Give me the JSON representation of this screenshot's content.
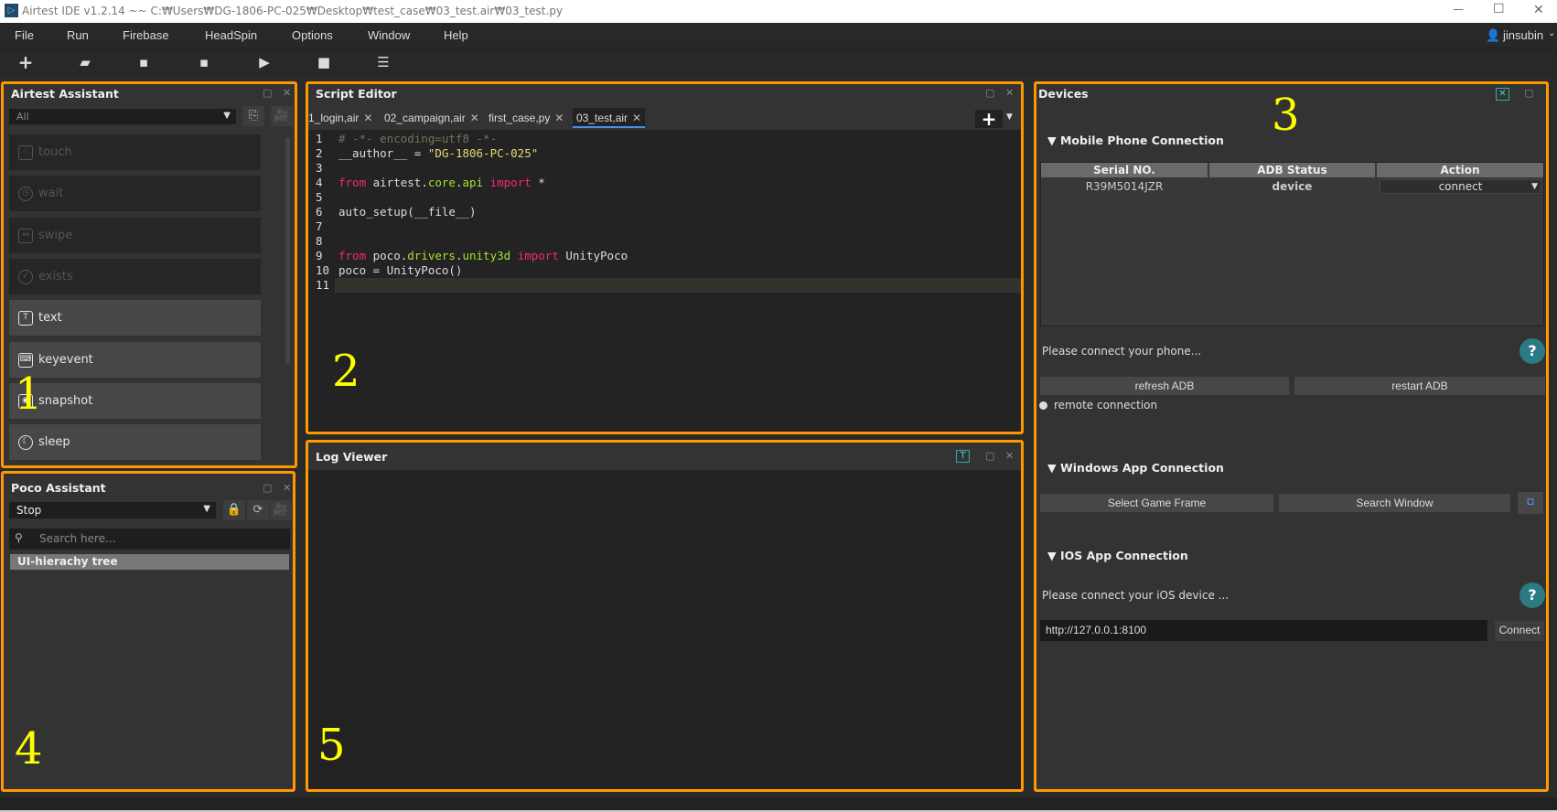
{
  "window": {
    "title": "Airtest IDE v1.2.14 ~~ C:₩Users₩DG-1806-PC-025₩Desktop₩test_case₩03_test.air₩03_test.py",
    "minimize": "—",
    "maximize": "☐",
    "close": "✕"
  },
  "menu": [
    "File",
    "Run",
    "Firebase",
    "HeadSpin",
    "Options",
    "Window",
    "Help"
  ],
  "user": {
    "name": "jinsubin"
  },
  "toolbar": {
    "icons": [
      "new-icon",
      "open-folder-icon",
      "save-icon",
      "save-as-icon",
      "run-icon",
      "stop-icon",
      "log-icon"
    ]
  },
  "airtest_assistant": {
    "title": "Airtest Assistant",
    "filter": "All",
    "items": [
      {
        "label": "touch",
        "enabled": false
      },
      {
        "label": "wait",
        "enabled": false
      },
      {
        "label": "swipe",
        "enabled": false
      },
      {
        "label": "exists",
        "enabled": false
      },
      {
        "label": "text",
        "enabled": true
      },
      {
        "label": "keyevent",
        "enabled": true
      },
      {
        "label": "snapshot",
        "enabled": true
      },
      {
        "label": "sleep",
        "enabled": true
      }
    ]
  },
  "poco_assistant": {
    "title": "Poco Assistant",
    "mode": "Stop",
    "search_placeholder": "Search here...",
    "tree_label": "UI-hierachy tree"
  },
  "script_editor": {
    "title": "Script Editor",
    "tabs": [
      {
        "label": "1_login,air",
        "active": false
      },
      {
        "label": "02_campaign,air",
        "active": false
      },
      {
        "label": "first_case,py",
        "active": false
      },
      {
        "label": "03_test,air",
        "active": true
      }
    ],
    "lines": [
      "# -*- encoding=utf8 -*-",
      "__author__ = \"DG-1806-PC-025\"",
      "",
      "from airtest.core.api import *",
      "",
      "auto_setup(__file__)",
      "",
      "",
      "from poco.drivers.unity3d import UnityPoco",
      "poco = UnityPoco()",
      ""
    ],
    "current_line": 11
  },
  "log_viewer": {
    "title": "Log Viewer"
  },
  "devices": {
    "title": "Devices",
    "mobile": {
      "heading": "Mobile Phone Connection",
      "columns": [
        "Serial NO.",
        "ADB Status",
        "Action"
      ],
      "rows": [
        {
          "serial": "R39M5014JZR",
          "status": "device",
          "action": "connect"
        }
      ],
      "hint": "Please connect your phone...",
      "refresh": "refresh ADB",
      "restart": "restart ADB",
      "remote": "remote connection"
    },
    "windows": {
      "heading": "Windows App Connection",
      "select": "Select Game Frame",
      "search": "Search Window"
    },
    "ios": {
      "heading": "IOS App Connection",
      "hint": "Please connect your iOS device ...",
      "url": "http://127.0.0.1:8100",
      "connect": "Connect"
    }
  },
  "annotations": [
    "1",
    "2",
    "3",
    "4",
    "5"
  ],
  "colors": {
    "highlight": "#ff9800",
    "annotation": "#ffff00",
    "help": "#2b7a84",
    "tab_underline": "#4a90e2"
  }
}
